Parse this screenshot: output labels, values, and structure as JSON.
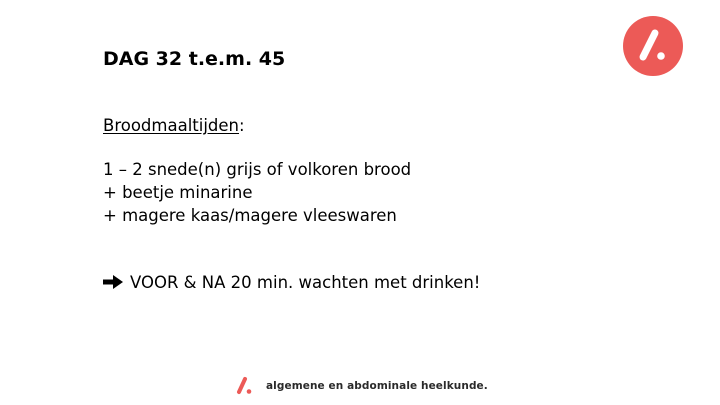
{
  "slide": {
    "title": "DAG 32 t.e.m. 45",
    "section_heading": "Broodmaaltijden",
    "section_heading_suffix": ":",
    "lines": [
      "1 – 2 snede(n) grijs of volkoren brood",
      "+ beetje minarine",
      "+ magere kaas/magere vleeswaren"
    ],
    "note": "VOOR & NA 20 min. wachten met drinken!",
    "note_icon": "right-arrow-icon"
  },
  "branding": {
    "logo_icon": "slash-dot-logo-icon",
    "footer_text": "algemene en abdominale heelkunde."
  },
  "colors": {
    "brand": "#ec5a57",
    "text": "#000000",
    "background": "#ffffff"
  }
}
